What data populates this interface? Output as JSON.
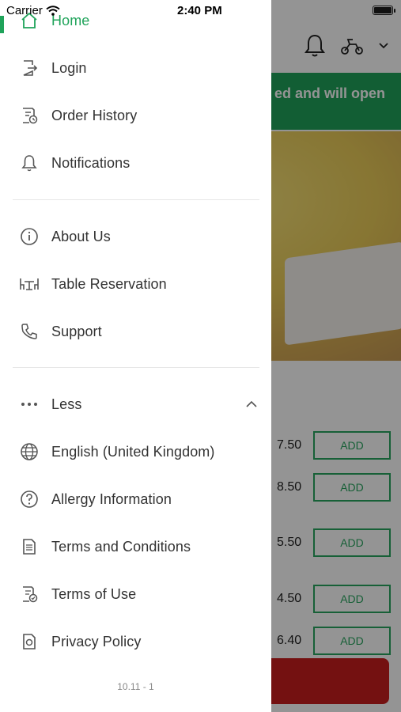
{
  "status_bar": {
    "carrier": "Carrier",
    "time": "2:40 PM"
  },
  "background": {
    "banner_text": "ed and will open",
    "items": [
      {
        "price": "7.50",
        "add": "ADD"
      },
      {
        "price": "8.50",
        "add": "ADD"
      },
      {
        "price": "5.50",
        "add": "ADD"
      },
      {
        "price": "4.50",
        "add": "ADD"
      },
      {
        "price": "6.40",
        "add": "ADD"
      }
    ]
  },
  "menu": {
    "home": "Home",
    "login": "Login",
    "order_history": "Order History",
    "notifications": "Notifications",
    "about_us": "About Us",
    "table_reservation": "Table Reservation",
    "support": "Support",
    "less": "Less",
    "language": "English (United Kingdom)",
    "allergy": "Allergy Information",
    "terms_conditions": "Terms and Conditions",
    "terms_use": "Terms of Use",
    "privacy": "Privacy Policy"
  },
  "version": "10.11 - 1",
  "colors": {
    "accent": "#1fa35a",
    "cta": "#c81e1e",
    "add_border": "#28a55f"
  },
  "icons": [
    "home-icon",
    "login-icon",
    "order-history-icon",
    "bell-icon",
    "info-icon",
    "table-icon",
    "phone-icon",
    "more-dots-icon",
    "globe-icon",
    "question-icon",
    "document-icon",
    "terms-check-icon",
    "privacy-icon",
    "chevron-up-icon",
    "bell-icon",
    "scooter-icon",
    "chevron-down-icon"
  ]
}
